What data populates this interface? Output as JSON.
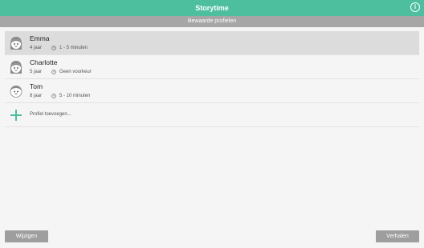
{
  "app": {
    "title": "Storytime"
  },
  "subheader": "Bewaarde profielen",
  "profiles": [
    {
      "name": "Emma",
      "age": "4 jaar",
      "duration": "1 - 5 minuten",
      "avatar": "girl-avatar-icon",
      "selected": true
    },
    {
      "name": "Charlotte",
      "age": "5 jaar",
      "duration": "Geen voorkeur",
      "avatar": "girl-avatar-icon",
      "selected": false
    },
    {
      "name": "Tom",
      "age": "8 jaar",
      "duration": "5 - 10 minuten",
      "avatar": "boy-avatar-icon",
      "selected": false
    }
  ],
  "add_profile_label": "Profiel toevoegen...",
  "buttons": {
    "edit": "Wijzigen",
    "stories": "Verhalen"
  },
  "colors": {
    "accent": "#4dbf9f",
    "subheader": "#a6a6a6",
    "button": "#9e9e9e",
    "selected_row": "#dcdcdc"
  }
}
